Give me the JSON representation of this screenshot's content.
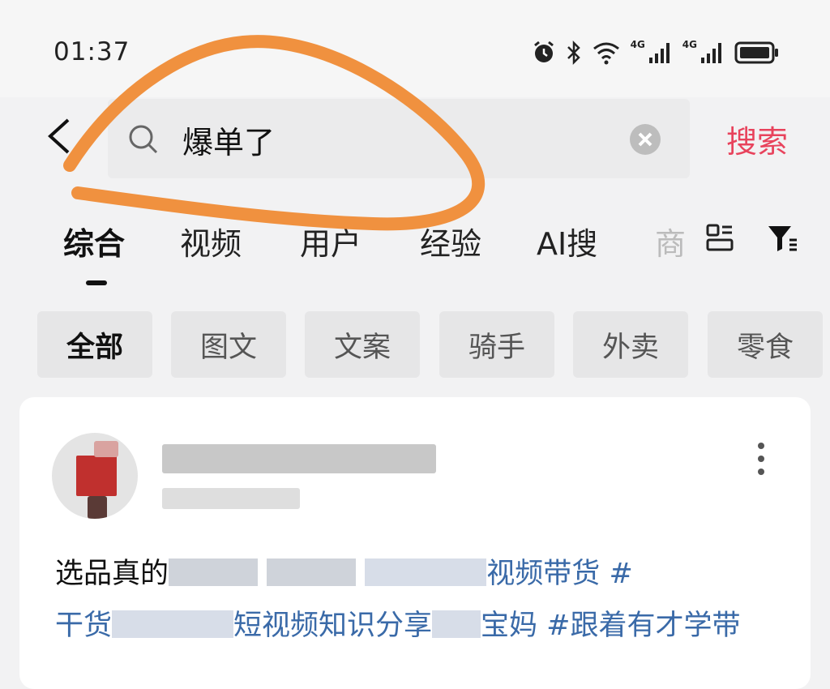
{
  "status_bar": {
    "time": "01:37",
    "network_1": "4G",
    "network_2": "4G",
    "icons": [
      "alarm-icon",
      "bluetooth-icon",
      "wifi-icon",
      "signal-icon",
      "signal-icon",
      "battery-icon"
    ]
  },
  "search": {
    "query": "爆单了",
    "submit_label": "搜索",
    "accent_color": "#e8435c"
  },
  "tabs": [
    {
      "label": "综合",
      "active": true
    },
    {
      "label": "视频"
    },
    {
      "label": "用户"
    },
    {
      "label": "经验"
    },
    {
      "label": "AI搜"
    },
    {
      "label": "商"
    }
  ],
  "chips": [
    {
      "label": "全部",
      "active": true
    },
    {
      "label": "图文"
    },
    {
      "label": "文案"
    },
    {
      "label": "骑手"
    },
    {
      "label": "外卖"
    },
    {
      "label": "零食"
    }
  ],
  "post": {
    "text_start": "选品真的",
    "tag_visible_1": "视频带货",
    "tag_hash": " #",
    "line2_prefix": "干货",
    "tag_visible_2": "短视频知识分享",
    "tag_visible_3": "宝妈",
    "tag_visible_4": " #跟着有才学带",
    "link_color": "#3a6aa8"
  },
  "annotation": {
    "color": "#f0913f"
  }
}
